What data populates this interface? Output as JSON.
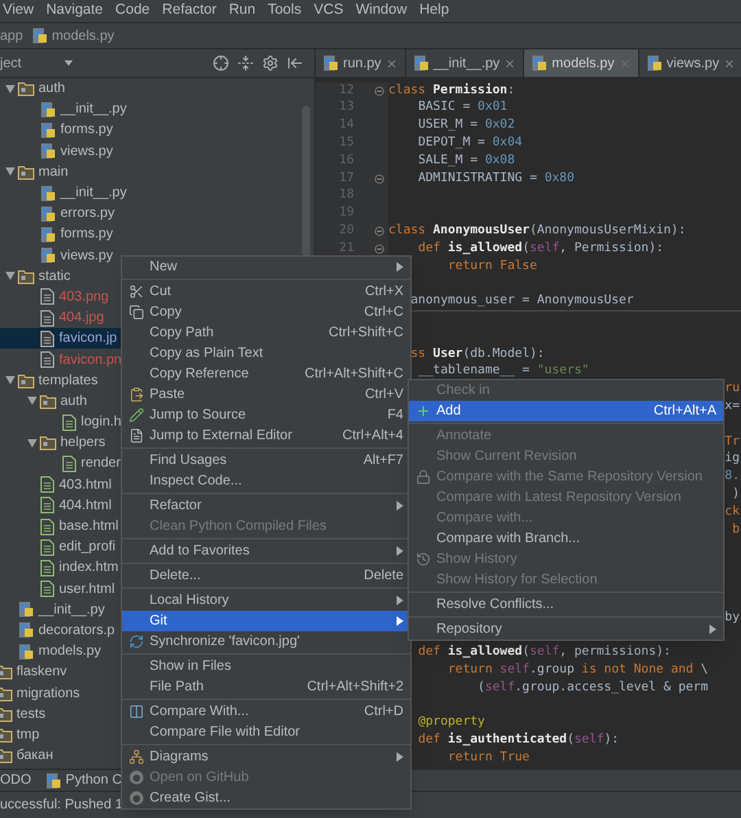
{
  "menubar": [
    "View",
    "Navigate",
    "Code",
    "Refactor",
    "Run",
    "Tools",
    "VCS",
    "Window",
    "Help"
  ],
  "breadcrumb": [
    {
      "label": "app",
      "kind": "plain"
    },
    {
      "label": "models.py",
      "kind": "python"
    }
  ],
  "project_panel": {
    "title": "ject"
  },
  "tabs": [
    {
      "label": "run.py",
      "selected": false
    },
    {
      "label": "__init__.py",
      "selected": false
    },
    {
      "label": "models.py",
      "selected": true
    },
    {
      "label": "views.py",
      "selected": false
    }
  ],
  "tree": {
    "app_children": [
      {
        "label": "auth",
        "kind": "folder",
        "expanded": true,
        "selected": false,
        "children": [
          {
            "label": "__init__.py",
            "kind": "python",
            "selected": false
          },
          {
            "label": "forms.py",
            "kind": "python",
            "selected": false
          },
          {
            "label": "views.py",
            "kind": "python",
            "selected": false
          }
        ]
      },
      {
        "label": "main",
        "kind": "folder",
        "expanded": true,
        "selected": false,
        "children": [
          {
            "label": "__init__.py",
            "kind": "python",
            "selected": false
          },
          {
            "label": "errors.py",
            "kind": "python",
            "selected": false
          },
          {
            "label": "forms.py",
            "kind": "python",
            "selected": false
          },
          {
            "label": "views.py",
            "kind": "python",
            "selected": false
          }
        ]
      },
      {
        "label": "static",
        "kind": "folder",
        "expanded": true,
        "selected": false,
        "children": [
          {
            "label": "403.png",
            "kind": "file",
            "selected": false,
            "color": "#c75450"
          },
          {
            "label": "404.jpg",
            "kind": "file",
            "selected": false,
            "color": "#c75450"
          },
          {
            "label": "favicon.jp",
            "kind": "file",
            "selected": true
          },
          {
            "label": "favicon.pn",
            "kind": "file",
            "selected": false,
            "color": "#c75450"
          }
        ]
      },
      {
        "label": "templates",
        "kind": "folder",
        "expanded": true,
        "selected": false,
        "children": [
          {
            "label": "auth",
            "kind": "folder",
            "expanded": true,
            "selected": false,
            "children": [
              {
                "label": "login.h",
                "kind": "html",
                "selected": false
              }
            ]
          },
          {
            "label": "helpers",
            "kind": "folder",
            "expanded": true,
            "selected": false,
            "children": [
              {
                "label": "render",
                "kind": "html",
                "selected": false
              }
            ]
          },
          {
            "label": "403.html",
            "kind": "html",
            "selected": false
          },
          {
            "label": "404.html",
            "kind": "html",
            "selected": false
          },
          {
            "label": "base.html",
            "kind": "html",
            "selected": false
          },
          {
            "label": "edit_profi",
            "kind": "html",
            "selected": false
          },
          {
            "label": "index.htm",
            "kind": "html",
            "selected": false
          },
          {
            "label": "user.html",
            "kind": "html",
            "selected": false
          }
        ]
      },
      {
        "label": "__init__.py",
        "kind": "python",
        "selected": false
      },
      {
        "label": "decorators.p",
        "kind": "python",
        "selected": false
      },
      {
        "label": "models.py",
        "kind": "python",
        "selected": false
      }
    ],
    "root_items": [
      {
        "label": "flaskenv",
        "kind": "folder",
        "selected": false
      },
      {
        "label": "migrations",
        "kind": "folder",
        "selected": false
      },
      {
        "label": "tests",
        "kind": "folder",
        "selected": false
      },
      {
        "label": "tmp",
        "kind": "folder",
        "selected": false
      },
      {
        "label": "бакан",
        "kind": "folder",
        "selected": false
      }
    ]
  },
  "editor": {
    "lines": [
      {
        "number": "12",
        "kind": "code",
        "fold": true,
        "tokens": [
          {
            "kind": "kw",
            "text": "class "
          },
          {
            "kind": "name",
            "text": "Permission"
          },
          {
            "kind": "plain",
            "text": ":"
          }
        ]
      },
      {
        "number": "13",
        "kind": "code",
        "tokens": [
          {
            "kind": "plain",
            "text": "    BASIC = "
          },
          {
            "kind": "num",
            "text": "0x01"
          }
        ]
      },
      {
        "number": "14",
        "kind": "code",
        "tokens": [
          {
            "kind": "plain",
            "text": "    USER_M = "
          },
          {
            "kind": "num",
            "text": "0x02"
          }
        ]
      },
      {
        "number": "15",
        "kind": "code",
        "tokens": [
          {
            "kind": "plain",
            "text": "    DEPOT_M = "
          },
          {
            "kind": "num",
            "text": "0x04"
          }
        ]
      },
      {
        "number": "16",
        "kind": "code",
        "tokens": [
          {
            "kind": "plain",
            "text": "    SALE_M = "
          },
          {
            "kind": "num",
            "text": "0x08"
          }
        ]
      },
      {
        "number": "17",
        "kind": "code",
        "fold": true,
        "tokens": [
          {
            "kind": "plain",
            "text": "    ADMINISTRATING = "
          },
          {
            "kind": "num",
            "text": "0x80"
          }
        ]
      },
      {
        "number": "18",
        "kind": "blank"
      },
      {
        "number": "19",
        "kind": "blank"
      },
      {
        "number": "20",
        "kind": "code",
        "fold": true,
        "tokens": [
          {
            "kind": "kw",
            "text": "class "
          },
          {
            "kind": "name",
            "text": "AnonymousUser"
          },
          {
            "kind": "plain",
            "text": "(AnonymousUserMixin):"
          }
        ]
      },
      {
        "number": "21",
        "kind": "code",
        "fold": true,
        "tokens": [
          {
            "kind": "kw",
            "text": "    def "
          },
          {
            "kind": "name",
            "text": "is_allowed"
          },
          {
            "kind": "plain",
            "text": "("
          },
          {
            "kind": "self",
            "text": "self"
          },
          {
            "kind": "plain",
            "text": ", Permission):"
          }
        ]
      },
      {
        "kind": "code",
        "tokens": [
          {
            "kind": "kw",
            "text": "        return False"
          }
        ]
      },
      {
        "kind": "blank"
      },
      {
        "kind": "code",
        "tokens": [
          {
            "kind": "plain",
            "text": "   anonymous_user = AnonymousUser"
          }
        ]
      },
      {
        "kind": "separator"
      },
      {
        "kind": "blank"
      },
      {
        "kind": "code",
        "tokens": [
          {
            "kind": "kw",
            "text": "   ss "
          },
          {
            "kind": "name",
            "text": "User"
          },
          {
            "kind": "plain",
            "text": "(db.Model):"
          }
        ]
      },
      {
        "kind": "code",
        "tokens": [
          {
            "kind": "plain",
            "text": "    __tablename__ = "
          },
          {
            "kind": "str",
            "text": "\"users\""
          }
        ]
      },
      {
        "kind": "edge",
        "tokens": [
          {
            "kind": "kw",
            "text": "ru"
          }
        ]
      },
      {
        "kind": "edge",
        "tokens": [
          {
            "kind": "plain",
            "text": "x="
          }
        ]
      },
      {
        "kind": "blank"
      },
      {
        "kind": "edge",
        "tokens": [
          {
            "kind": "kw",
            "text": "Tr"
          }
        ]
      },
      {
        "kind": "edge",
        "tokens": [
          {
            "kind": "plain",
            "text": "ig"
          }
        ]
      },
      {
        "kind": "edge",
        "tokens": [
          {
            "kind": "num",
            "text": "8."
          }
        ]
      },
      {
        "kind": "edge",
        "tokens": [
          {
            "kind": "plain",
            "text": ")"
          }
        ]
      },
      {
        "kind": "edge",
        "tokens": [
          {
            "kind": "kw",
            "text": "ck"
          }
        ]
      },
      {
        "kind": "edge",
        "tokens": [
          {
            "kind": "kw",
            "text": "b"
          }
        ]
      },
      {
        "kind": "blank"
      },
      {
        "kind": "blank"
      },
      {
        "kind": "blank"
      },
      {
        "kind": "blank"
      },
      {
        "kind": "edge",
        "tokens": [
          {
            "kind": "plain",
            "text": "by"
          }
        ]
      },
      {
        "kind": "blank"
      },
      {
        "kind": "code",
        "tokens": [
          {
            "kind": "kw",
            "text": "    def "
          },
          {
            "kind": "name",
            "text": "is_allowed"
          },
          {
            "kind": "plain",
            "text": "("
          },
          {
            "kind": "self",
            "text": "self"
          },
          {
            "kind": "plain",
            "text": ", permissions):"
          }
        ]
      },
      {
        "kind": "code",
        "tokens": [
          {
            "kind": "kw",
            "text": "        return "
          },
          {
            "kind": "self",
            "text": "self"
          },
          {
            "kind": "plain",
            "text": ".group "
          },
          {
            "kind": "kw",
            "text": "is not None and "
          },
          {
            "kind": "plain",
            "text": "\\"
          }
        ]
      },
      {
        "kind": "code",
        "tokens": [
          {
            "kind": "plain",
            "text": "            ("
          },
          {
            "kind": "self",
            "text": "self"
          },
          {
            "kind": "plain",
            "text": ".group.access_level & perm"
          }
        ]
      },
      {
        "kind": "blank"
      },
      {
        "kind": "code",
        "tokens": [
          {
            "kind": "deco",
            "text": "    @property"
          }
        ]
      },
      {
        "kind": "code",
        "tokens": [
          {
            "kind": "kw",
            "text": "    def "
          },
          {
            "kind": "name",
            "text": "is_authenticated"
          },
          {
            "kind": "plain",
            "text": "("
          },
          {
            "kind": "self",
            "text": "self"
          },
          {
            "kind": "plain",
            "text": "):"
          }
        ]
      },
      {
        "kind": "code",
        "tokens": [
          {
            "kind": "kw",
            "text": "        return True"
          }
        ]
      }
    ]
  },
  "tool_window_bar": [
    {
      "label": "ODO",
      "kind": "plain"
    },
    {
      "label": "Python C",
      "kind": "console"
    }
  ],
  "status_bar": "uccessful: Pushed 1",
  "context_menu": {
    "items": [
      {
        "kind": "item",
        "label": "New",
        "selected": false,
        "disabled": false,
        "submenu": true
      },
      {
        "kind": "separator"
      },
      {
        "kind": "item",
        "label": "Cut",
        "shortcut": "Ctrl+X",
        "selected": false,
        "disabled": false
      },
      {
        "kind": "item",
        "label": "Copy",
        "shortcut": "Ctrl+C",
        "selected": false,
        "disabled": false
      },
      {
        "kind": "item",
        "label": "Copy Path",
        "shortcut": "Ctrl+Shift+C",
        "selected": false,
        "disabled": false
      },
      {
        "kind": "item",
        "label": "Copy as Plain Text",
        "selected": false,
        "disabled": false
      },
      {
        "kind": "item",
        "label": "Copy Reference",
        "shortcut": "Ctrl+Alt+Shift+C",
        "selected": false,
        "disabled": false
      },
      {
        "kind": "item",
        "label": "Paste",
        "shortcut": "Ctrl+V",
        "selected": false,
        "disabled": false
      },
      {
        "kind": "item",
        "label": "Jump to Source",
        "shortcut": "F4",
        "selected": false,
        "disabled": false
      },
      {
        "kind": "item",
        "label": "Jump to External Editor",
        "shortcut": "Ctrl+Alt+4",
        "selected": false,
        "disabled": false
      },
      {
        "kind": "separator"
      },
      {
        "kind": "item",
        "label": "Find Usages",
        "shortcut": "Alt+F7",
        "selected": false,
        "disabled": false
      },
      {
        "kind": "item",
        "label": "Inspect Code...",
        "selected": false,
        "disabled": false
      },
      {
        "kind": "separator"
      },
      {
        "kind": "item",
        "label": "Refactor",
        "selected": false,
        "disabled": false,
        "submenu": true
      },
      {
        "kind": "item",
        "label": "Clean Python Compiled Files",
        "selected": false,
        "disabled": true
      },
      {
        "kind": "separator"
      },
      {
        "kind": "item",
        "label": "Add to Favorites",
        "selected": false,
        "disabled": false,
        "submenu": true
      },
      {
        "kind": "separator"
      },
      {
        "kind": "item",
        "label": "Delete...",
        "shortcut": "Delete",
        "selected": false,
        "disabled": false
      },
      {
        "kind": "separator"
      },
      {
        "kind": "item",
        "label": "Local History",
        "selected": false,
        "disabled": false,
        "submenu": true
      },
      {
        "kind": "item",
        "label": "Git",
        "selected": true,
        "disabled": false,
        "submenu": true
      },
      {
        "kind": "item",
        "label": "Synchronize 'favicon.jpg'",
        "selected": false,
        "disabled": false
      },
      {
        "kind": "separator"
      },
      {
        "kind": "item",
        "label": "Show in Files",
        "selected": false,
        "disabled": false
      },
      {
        "kind": "item",
        "label": "File Path",
        "shortcut": "Ctrl+Alt+Shift+2",
        "selected": false,
        "disabled": false
      },
      {
        "kind": "separator"
      },
      {
        "kind": "item",
        "label": "Compare With...",
        "shortcut": "Ctrl+D",
        "selected": false,
        "disabled": false
      },
      {
        "kind": "item",
        "label": "Compare File with Editor",
        "selected": false,
        "disabled": false
      },
      {
        "kind": "separator"
      },
      {
        "kind": "item",
        "label": "Diagrams",
        "selected": false,
        "disabled": false,
        "submenu": true
      },
      {
        "kind": "item",
        "label": "Open on GitHub",
        "selected": false,
        "disabled": true
      },
      {
        "kind": "item",
        "label": "Create Gist...",
        "selected": false,
        "disabled": false
      }
    ]
  },
  "git_submenu": {
    "items": [
      {
        "kind": "item",
        "label": "Check in",
        "selected": false,
        "disabled": true
      },
      {
        "kind": "item",
        "label": "Add",
        "shortcut": "Ctrl+Alt+A",
        "selected": true,
        "disabled": false
      },
      {
        "kind": "separator"
      },
      {
        "kind": "item",
        "label": "Annotate",
        "selected": false,
        "disabled": true
      },
      {
        "kind": "item",
        "label": "Show Current Revision",
        "selected": false,
        "disabled": true
      },
      {
        "kind": "item",
        "label": "Compare with the Same Repository Version",
        "selected": false,
        "disabled": true
      },
      {
        "kind": "item",
        "label": "Compare with Latest Repository Version",
        "selected": false,
        "disabled": true
      },
      {
        "kind": "item",
        "label": "Compare with...",
        "selected": false,
        "disabled": true
      },
      {
        "kind": "item",
        "label": "Compare with Branch...",
        "selected": false,
        "disabled": false
      },
      {
        "kind": "item",
        "label": "Show History",
        "selected": false,
        "disabled": true
      },
      {
        "kind": "item",
        "label": "Show History for Selection",
        "selected": false,
        "disabled": true
      },
      {
        "kind": "separator"
      },
      {
        "kind": "item",
        "label": "Resolve Conflicts...",
        "selected": false,
        "disabled": false
      },
      {
        "kind": "separator"
      },
      {
        "kind": "item",
        "label": "Repository",
        "selected": false,
        "disabled": false,
        "submenu": true
      }
    ]
  }
}
